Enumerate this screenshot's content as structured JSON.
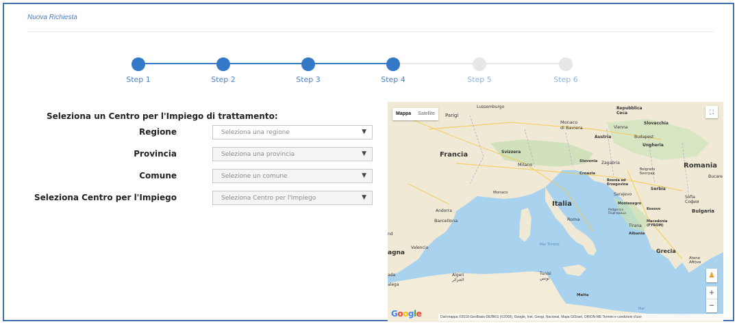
{
  "breadcrumb": "Nuova Richiesta",
  "steps": [
    {
      "label": "Step 1",
      "state": "done"
    },
    {
      "label": "Step 2",
      "state": "done"
    },
    {
      "label": "Step 3",
      "state": "done"
    },
    {
      "label": "Step 4",
      "state": "done"
    },
    {
      "label": "Step 5",
      "state": "todo"
    },
    {
      "label": "Step 6",
      "state": "todo"
    }
  ],
  "form": {
    "title": "Seleziona un Centro per l'Impiego di trattamento:",
    "regione_label": "Regione",
    "regione_value": "Seleziona una regione",
    "provincia_label": "Provincia",
    "provincia_value": "Seleziona una provincia",
    "comune_label": "Comune",
    "comune_value": "Selezione un comune",
    "centro_label": "Seleziona Centro per l'Impiego",
    "centro_value": "Seleziona Centro per l'Impiego"
  },
  "map": {
    "type_map": "Mappa",
    "type_satellite": "Satellite",
    "zoom_in": "+",
    "zoom_out": "−",
    "attribution": "Dati mappa ©2018 GeoBasis-DE/BKG (©2009), Google, Inst. Geogr. Nacional, Mapa GISrael, ORION-ME   Termini e condizioni d'uso",
    "labels": {
      "francia": "Francia",
      "italia": "Italia",
      "romania": "Romania",
      "grecia": "Grecia",
      "parigi": "Parigi",
      "lussemburgo": "Lussemburgo",
      "monaco_baviera": "Monaco\ndi Baviera",
      "repubblica_ceca": "Repubblica\nCeca",
      "slovacchia": "Slovacchia",
      "vienna": "Vienna",
      "budapest": "Budapest",
      "austria": "Austria",
      "ungheria": "Ungheria",
      "svizzera": "Svizzera",
      "slovenia": "Slovenia",
      "zagabria": "Zagabria",
      "croazia": "Croazia",
      "milano": "Milano",
      "belgrado": "Belgrado\nБеоград",
      "bosnia": "Bosnia ed\nErzegovina",
      "serbia": "Serbia",
      "sarajevo": "Sarajevo",
      "montenegro": "Montenegro",
      "kosovo": "Kosovo",
      "sofia": "Sofia\nСофия",
      "bulgaria": "Bulgaria",
      "bucarest": "Bucare",
      "monaco": "Monaco",
      "andorra": "Andorra",
      "barcellona": "Barcellona",
      "roma": "Roma",
      "tirana": "Tirana",
      "albania": "Albania",
      "macedonia": "Macedonia\n(FYROM)",
      "podgorica": "Podgorica\nПодгорица",
      "valencia": "Valencia",
      "spagna": "agna",
      "mar_tirreno": "Mar Tirreno",
      "algeri": "Algeri\nالجزائر",
      "tunisi": "Tunisi\nتونس",
      "malta": "Malta",
      "atene": "Atene\nΑθήνα",
      "mar": "Mar",
      "nd": "nd",
      "ada": "ada",
      "alega": "alega"
    }
  }
}
